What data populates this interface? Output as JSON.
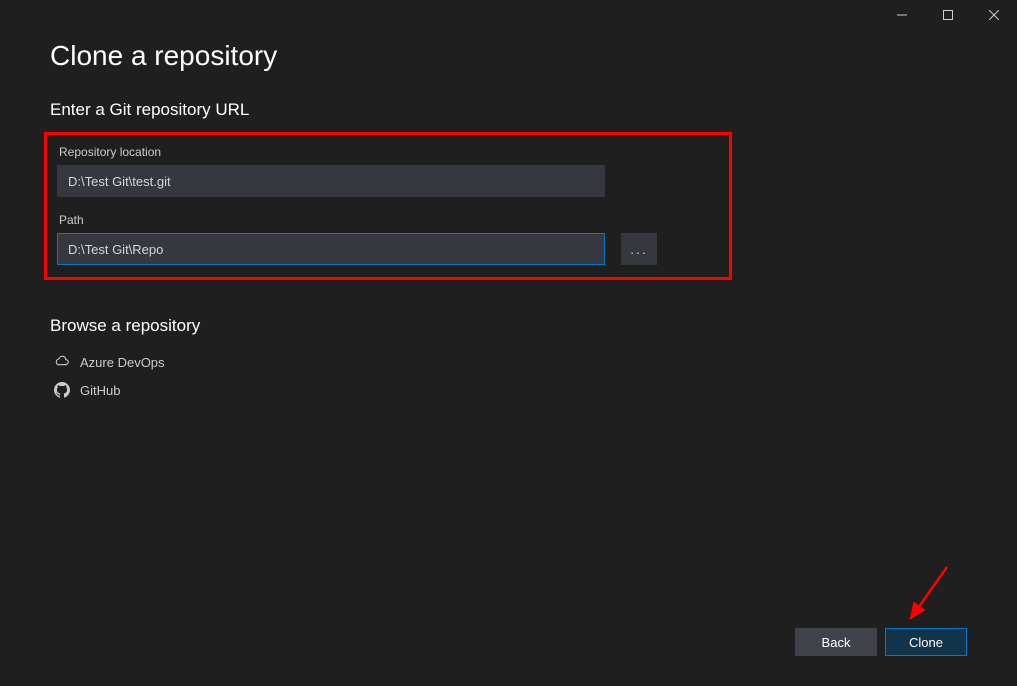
{
  "titlebar": {
    "minimize": "minimize",
    "maximize": "maximize",
    "close": "close"
  },
  "page": {
    "title": "Clone a repository"
  },
  "enter_url": {
    "heading": "Enter a Git repository URL",
    "repo_location_label": "Repository location",
    "repo_location_value": "D:\\Test Git\\test.git",
    "path_label": "Path",
    "path_value": "D:\\Test Git\\Repo",
    "browse_label": "..."
  },
  "browse_repo": {
    "heading": "Browse a repository",
    "items": [
      {
        "label": "Azure DevOps"
      },
      {
        "label": "GitHub"
      }
    ]
  },
  "footer": {
    "back_label": "Back",
    "clone_label": "Clone"
  },
  "colors": {
    "background": "#1f1f1f",
    "input_bg": "#363840",
    "accent": "#007acc",
    "highlight": "#ff0000"
  }
}
